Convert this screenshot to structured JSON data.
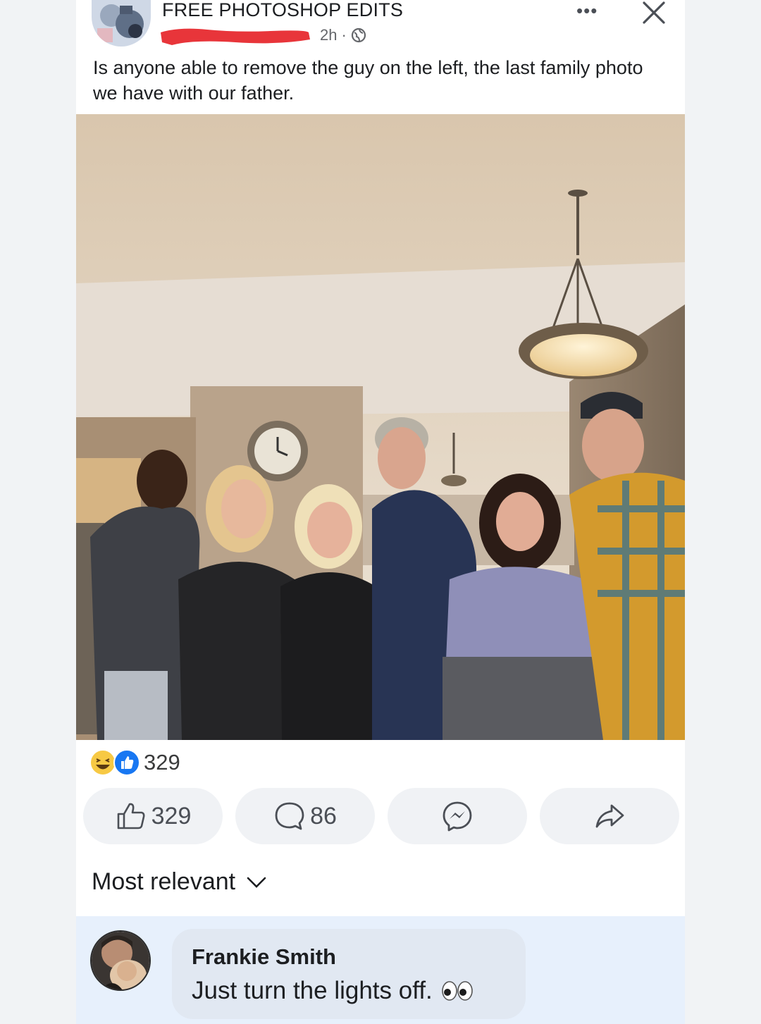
{
  "post": {
    "group_name": "FREE PHOTOSHOP EDITS",
    "time": "2h",
    "separator": "·",
    "privacy_icon": "globe-icon",
    "menu_icon": "more-icon",
    "close_icon": "close-icon",
    "text": "Is anyone able to remove the guy on the left, the last family photo we have with our father."
  },
  "reactions": {
    "icons": [
      "haha-icon",
      "like-icon"
    ],
    "count": "329"
  },
  "actions": {
    "like_count": "329",
    "comment_count": "86",
    "like_icon": "thumbs-up-icon",
    "comment_icon": "comment-icon",
    "messenger_icon": "messenger-icon",
    "share_icon": "share-icon"
  },
  "comments": {
    "sort_label": "Most relevant",
    "sort_icon": "chevron-down-icon",
    "items": [
      {
        "author": "Frankie Smith",
        "text": "Just turn the lights off.",
        "emoji_icon": "eyes-icon"
      }
    ]
  },
  "colors": {
    "page_background": "#f1f3f5",
    "card_background": "#ffffff",
    "button_background": "#f0f2f5",
    "comment_highlight": "#e7f0fc",
    "like_blue": "#1877f2",
    "redaction_red": "#e8353a"
  }
}
